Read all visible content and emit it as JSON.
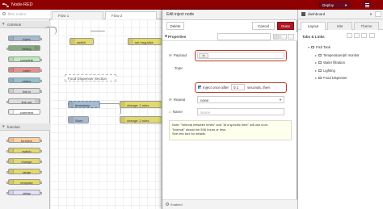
{
  "app": {
    "title": "Node-RED",
    "deploy_label": "Deploy"
  },
  "palette": {
    "search_placeholder": "filter nodes",
    "categories": [
      {
        "name": "common",
        "nodes": [
          "inject",
          "debug",
          "complete",
          "catch",
          "status",
          "link in",
          "link out",
          "comment"
        ]
      },
      {
        "name": "function",
        "nodes": [
          "function",
          "switch",
          "change",
          "range",
          "template",
          "delay"
        ]
      }
    ]
  },
  "workspace": {
    "tabs": [
      "Flow 1",
      "Flow 2"
    ],
    "nodes": {
      "switch": "switch",
      "set_msg": "set msg.take",
      "comment": "Food Dispenser Section",
      "timestamp": "timestamp",
      "store": "Store",
      "change1": "change: 1 rules",
      "change2": "change: 2 rules"
    }
  },
  "dialog": {
    "title": "Edit inject node",
    "delete_label": "Delete",
    "cancel_label": "Cancel",
    "done_label": "Done",
    "properties_label": "Properties",
    "payload_label": "Payload",
    "topic_label": "Topic",
    "payload_type": "ts",
    "inject_once_label": "Inject once after",
    "inject_once_value": "0.1",
    "inject_once_suffix": "seconds, then",
    "repeat_label": "Repeat",
    "repeat_value": "none",
    "name_label": "Name",
    "name_placeholder": "Name",
    "note_line1": "Note: \"interval between times\" and \"at a specific time\" will use cron.",
    "note_line2": "\"interval\" should be 596 hours or less.",
    "note_line3": "See info box for details.",
    "enabled_label": "Enabled"
  },
  "sidebar": {
    "title": "dashboard",
    "tabs": [
      "Layout",
      "Site",
      "Theme"
    ],
    "section": "Tabs & Links",
    "tree": [
      "Fish Tank",
      "Temperature/ph monitor",
      "Water filtration",
      "Lighting",
      "Food Dispenser"
    ]
  },
  "colors": {
    "header": "#8f0000",
    "done": "#ad1625",
    "highlight": "#c0392b"
  }
}
